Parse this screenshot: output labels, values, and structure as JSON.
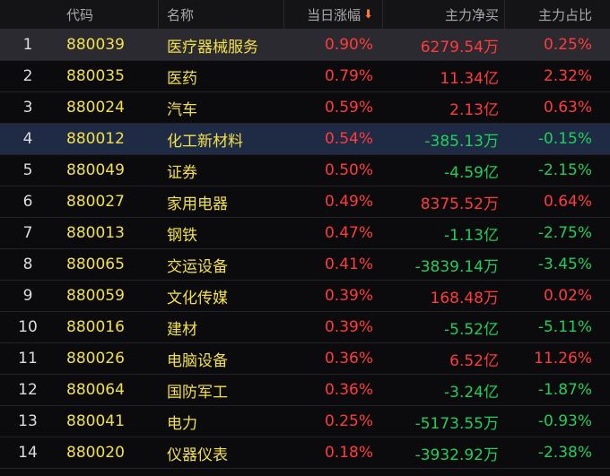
{
  "header": {
    "code": "代码",
    "name": "名称",
    "change": "当日涨幅",
    "sort_arrow": "⬇",
    "net_buy": "主力净买",
    "ratio": "主力占比"
  },
  "colors": {
    "up": "#ff3b3b",
    "down": "#1fcf5a",
    "code_name": "#f2e04a"
  },
  "rows": [
    {
      "idx": "1",
      "code": "880039",
      "name": "医疗器械服务",
      "change": "0.90%",
      "net": "6279.54万",
      "ratio": "0.25%",
      "dir": "up"
    },
    {
      "idx": "2",
      "code": "880035",
      "name": "医药",
      "change": "0.79%",
      "net": "11.34亿",
      "ratio": "2.32%",
      "dir": "up"
    },
    {
      "idx": "3",
      "code": "880024",
      "name": "汽车",
      "change": "0.59%",
      "net": "2.13亿",
      "ratio": "0.63%",
      "dir": "up"
    },
    {
      "idx": "4",
      "code": "880012",
      "name": "化工新材料",
      "change": "0.54%",
      "net": "-385.13万",
      "ratio": "-0.15%",
      "dir": "down"
    },
    {
      "idx": "5",
      "code": "880049",
      "name": "证券",
      "change": "0.50%",
      "net": "-4.59亿",
      "ratio": "-2.15%",
      "dir": "down"
    },
    {
      "idx": "6",
      "code": "880027",
      "name": "家用电器",
      "change": "0.49%",
      "net": "8375.52万",
      "ratio": "0.64%",
      "dir": "up"
    },
    {
      "idx": "7",
      "code": "880013",
      "name": "钢铁",
      "change": "0.47%",
      "net": "-1.13亿",
      "ratio": "-2.75%",
      "dir": "down"
    },
    {
      "idx": "8",
      "code": "880065",
      "name": "交运设备",
      "change": "0.41%",
      "net": "-3839.14万",
      "ratio": "-3.45%",
      "dir": "down"
    },
    {
      "idx": "9",
      "code": "880059",
      "name": "文化传媒",
      "change": "0.39%",
      "net": "168.48万",
      "ratio": "0.02%",
      "dir": "up"
    },
    {
      "idx": "10",
      "code": "880016",
      "name": "建材",
      "change": "0.39%",
      "net": "-5.52亿",
      "ratio": "-5.11%",
      "dir": "down"
    },
    {
      "idx": "11",
      "code": "880026",
      "name": "电脑设备",
      "change": "0.36%",
      "net": "6.52亿",
      "ratio": "11.26%",
      "dir": "up"
    },
    {
      "idx": "12",
      "code": "880064",
      "name": "国防军工",
      "change": "0.36%",
      "net": "-3.24亿",
      "ratio": "-1.87%",
      "dir": "down"
    },
    {
      "idx": "13",
      "code": "880041",
      "name": "电力",
      "change": "0.25%",
      "net": "-5173.55万",
      "ratio": "-0.93%",
      "dir": "down"
    },
    {
      "idx": "14",
      "code": "880020",
      "name": "仪器仪表",
      "change": "0.18%",
      "net": "-3932.92万",
      "ratio": "-2.38%",
      "dir": "down"
    }
  ]
}
